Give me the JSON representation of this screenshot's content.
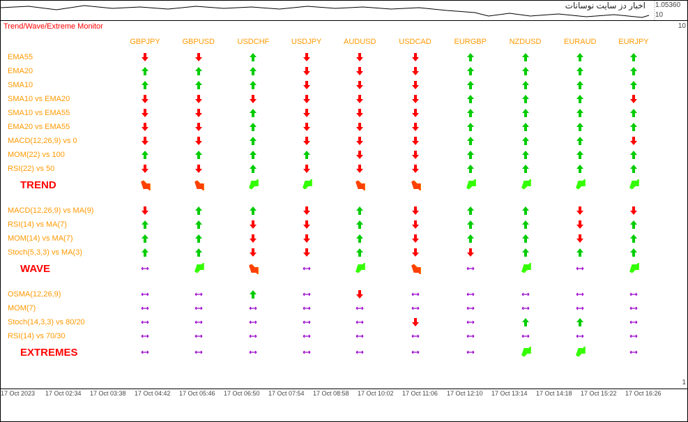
{
  "top_left_text": "",
  "top_script_text": "اخبار دز سایت نوسانات",
  "price_label": "1.05360",
  "top_scale": "10",
  "panel_title": "Trend/Wave/Extreme Monitor",
  "pairs": [
    "GBPJPY",
    "GBPUSD",
    "USDCHF",
    "USDJPY",
    "AUDUSD",
    "USDCAD",
    "EURGBP",
    "NZDUSD",
    "EURAUD",
    "EURJPY"
  ],
  "trend_rows": [
    {
      "label": "EMA55",
      "vals": [
        "dn",
        "dn",
        "up",
        "dn",
        "dn",
        "dn",
        "up",
        "up",
        "up",
        "up"
      ]
    },
    {
      "label": "EMA20",
      "vals": [
        "up",
        "up",
        "up",
        "dn",
        "dn",
        "dn",
        "up",
        "up",
        "up",
        "up"
      ]
    },
    {
      "label": "SMA10",
      "vals": [
        "up",
        "up",
        "up",
        "dn",
        "dn",
        "dn",
        "up",
        "up",
        "up",
        "up"
      ]
    },
    {
      "label": "SMA10 vs EMA20",
      "vals": [
        "dn",
        "dn",
        "dn",
        "dn",
        "dn",
        "dn",
        "up",
        "up",
        "up",
        "dn"
      ]
    },
    {
      "label": "SMA10 vs EMA55",
      "vals": [
        "dn",
        "dn",
        "up",
        "dn",
        "dn",
        "dn",
        "up",
        "up",
        "up",
        "up"
      ]
    },
    {
      "label": "EMA20 vs EMA55",
      "vals": [
        "dn",
        "dn",
        "up",
        "dn",
        "dn",
        "dn",
        "up",
        "up",
        "up",
        "up"
      ]
    },
    {
      "label": "MACD(12,26,9) vs 0",
      "vals": [
        "dn",
        "dn",
        "up",
        "dn",
        "dn",
        "dn",
        "up",
        "up",
        "up",
        "dn"
      ]
    },
    {
      "label": "MOM(22) vs 100",
      "vals": [
        "up",
        "up",
        "up",
        "up",
        "dn",
        "dn",
        "up",
        "up",
        "up",
        "up"
      ]
    },
    {
      "label": "RSI(22) vs 50",
      "vals": [
        "dn",
        "dn",
        "up",
        "dn",
        "dn",
        "dn",
        "up",
        "up",
        "up",
        "up"
      ]
    }
  ],
  "trend_summary": {
    "label": "TREND",
    "vals": [
      "ddr",
      "ddr",
      "dug",
      "dug",
      "ddr",
      "ddr",
      "dug",
      "dug",
      "dug",
      "dug"
    ]
  },
  "wave_rows": [
    {
      "label": "MACD(12,26,9) vs MA(9)",
      "vals": [
        "dn",
        "up",
        "up",
        "dn",
        "up",
        "dn",
        "up",
        "up",
        "dn",
        "dn"
      ]
    },
    {
      "label": "RSI(14) vs MA(7)",
      "vals": [
        "up",
        "up",
        "dn",
        "dn",
        "up",
        "dn",
        "up",
        "up",
        "dn",
        "up"
      ]
    },
    {
      "label": "MOM(14) vs MA(7)",
      "vals": [
        "up",
        "up",
        "dn",
        "dn",
        "up",
        "dn",
        "up",
        "up",
        "dn",
        "up"
      ]
    },
    {
      "label": "Stoch(5,3,3) vs MA(3)",
      "vals": [
        "up",
        "up",
        "dn",
        "dn",
        "up",
        "dn",
        "dn",
        "up",
        "up",
        "up"
      ]
    }
  ],
  "wave_summary": {
    "label": "WAVE",
    "vals": [
      "flat",
      "dug",
      "ddr",
      "flat",
      "dug",
      "ddr",
      "flat",
      "dug",
      "flat",
      "dug"
    ]
  },
  "ext_rows": [
    {
      "label": "OSMA(12,26,9)",
      "vals": [
        "flat",
        "flat",
        "up",
        "flat",
        "dn",
        "flat",
        "flat",
        "flat",
        "flat",
        "flat"
      ]
    },
    {
      "label": "MOM(7)",
      "vals": [
        "flat",
        "flat",
        "flat",
        "flat",
        "flat",
        "flat",
        "flat",
        "flat",
        "flat",
        "flat"
      ]
    },
    {
      "label": "Stoch(14,3,3) vs 80/20",
      "vals": [
        "flat",
        "flat",
        "flat",
        "flat",
        "flat",
        "dn",
        "flat",
        "up",
        "up",
        "flat"
      ]
    },
    {
      "label": "RSI(14) vs 70/30",
      "vals": [
        "flat",
        "flat",
        "flat",
        "flat",
        "flat",
        "flat",
        "flat",
        "flat",
        "flat",
        "flat"
      ]
    }
  ],
  "ext_summary": {
    "label": "EXTREMES",
    "vals": [
      "flat",
      "flat",
      "flat",
      "flat",
      "flat",
      "flat",
      "flat",
      "dug",
      "dug",
      "flat"
    ]
  },
  "y_top": "10",
  "y_bot": "1",
  "xaxis": [
    "17 Oct 2023",
    "17 Oct 02:34",
    "17 Oct 03:38",
    "17 Oct 04:42",
    "17 Oct 05:46",
    "17 Oct 06:50",
    "17 Oct 07:54",
    "17 Oct 08:58",
    "17 Oct 10:02",
    "17 Oct 11:06",
    "17 Oct 12:10",
    "17 Oct 13:14",
    "17 Oct 14:18",
    "17 Oct 15:22",
    "17 Oct 16:26"
  ]
}
